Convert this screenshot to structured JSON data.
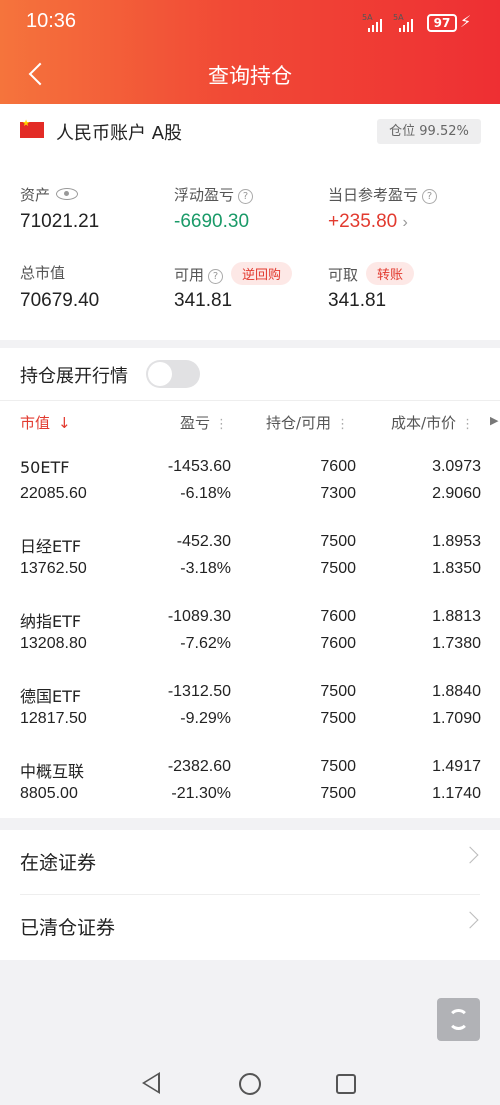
{
  "status": {
    "time": "10:36",
    "signal1": "5A",
    "signal2": "5A",
    "battery": "97"
  },
  "header": {
    "title": "查询持仓"
  },
  "account": {
    "name": "人民币账户 A股",
    "position": "仓位 99.52%"
  },
  "summary": {
    "assets_label": "资产",
    "assets": "71021.21",
    "float_pl_label": "浮动盈亏",
    "float_pl": "-6690.30",
    "today_pl_label": "当日参考盈亏",
    "today_pl": "+235.80",
    "market_value_label": "总市值",
    "market_value": "70679.40",
    "available_label": "可用",
    "available": "341.81",
    "repo_label": "逆回购",
    "withdrawable_label": "可取",
    "withdrawable": "341.81",
    "transfer_label": "转账"
  },
  "holdings": {
    "expand_label": "持仓展开行情",
    "columns": {
      "market_value": "市值",
      "pl": "盈亏",
      "position": "持仓/可用",
      "cost": "成本/市价"
    },
    "rows": [
      {
        "name": "50ETF",
        "value": "22085.60",
        "pl": "-1453.60",
        "pl_pct": "-6.18%",
        "hold": "7600",
        "avail": "7300",
        "cost": "3.0973",
        "price": "2.9060"
      },
      {
        "name": "日经ETF",
        "value": "13762.50",
        "pl": "-452.30",
        "pl_pct": "-3.18%",
        "hold": "7500",
        "avail": "7500",
        "cost": "1.8953",
        "price": "1.8350"
      },
      {
        "name": "纳指ETF",
        "value": "13208.80",
        "pl": "-1089.30",
        "pl_pct": "-7.62%",
        "hold": "7600",
        "avail": "7600",
        "cost": "1.8813",
        "price": "1.7380"
      },
      {
        "name": "德国ETF",
        "value": "12817.50",
        "pl": "-1312.50",
        "pl_pct": "-9.29%",
        "hold": "7500",
        "avail": "7500",
        "cost": "1.8840",
        "price": "1.7090"
      },
      {
        "name": "中概互联",
        "value": "8805.00",
        "pl": "-2382.60",
        "pl_pct": "-21.30%",
        "hold": "7500",
        "avail": "7500",
        "cost": "1.4917",
        "price": "1.1740"
      }
    ]
  },
  "links": {
    "in_transit": "在途证券",
    "cleared": "已清仓证券"
  },
  "colors": {
    "accent": "#ee2f33",
    "loss": "#1a9a68",
    "gain": "#e23a2f"
  }
}
